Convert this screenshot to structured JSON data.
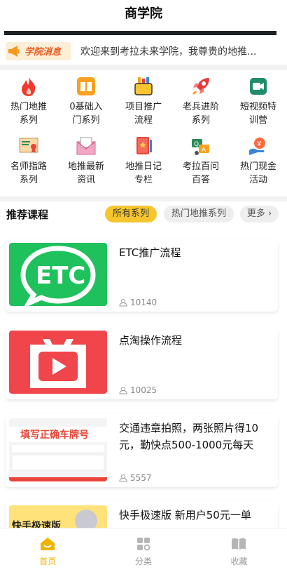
{
  "header": {
    "title": "商学院"
  },
  "notice": {
    "badge": "学院消息",
    "text": "欢迎来到考拉未来学院，我尊贵的地推..."
  },
  "grid": {
    "items": [
      {
        "label": "热门地推系列",
        "icon": "fire-icon"
      },
      {
        "label": "0基础入门系列",
        "icon": "book-icon"
      },
      {
        "label": "项目推广流程",
        "icon": "briefcase-icon"
      },
      {
        "label": "老兵进阶系列",
        "icon": "rocket-icon"
      },
      {
        "label": "短视频特训营",
        "icon": "video-camera-icon"
      },
      {
        "label": "名师指路系列",
        "icon": "certificate-icon"
      },
      {
        "label": "地推最新资讯",
        "icon": "envelope-icon"
      },
      {
        "label": "地推日记专栏",
        "icon": "diary-icon"
      },
      {
        "label": "考拉百问百答",
        "icon": "qa-chat-icon"
      },
      {
        "label": "热门现金活动",
        "icon": "cash-hand-icon"
      }
    ]
  },
  "recommend": {
    "title": "推荐课程",
    "chips": {
      "all": "所有系列",
      "hot": "热门地推系列",
      "more": "更多"
    }
  },
  "courses": [
    {
      "title": "ETC推广流程",
      "views": "10140",
      "thumb_text": "ETC"
    },
    {
      "title": "点淘操作流程",
      "views": "10025"
    },
    {
      "title": "交通违章拍照，两张照片得10元，勤快点500-1000元每天",
      "views": "5557",
      "thumb_text": "填写正确车牌号"
    },
    {
      "title": "快手极速版 新用户50元一单",
      "views": "",
      "thumb_text": "快手极速版"
    }
  ],
  "tabbar": {
    "home": "首页",
    "category": "分类",
    "favorites": "收藏"
  },
  "colors": {
    "accent": "#f7c62e",
    "active_tab": "#f0b400",
    "etc_green": "#1fc15c",
    "diantao_red": "#f0454a"
  }
}
